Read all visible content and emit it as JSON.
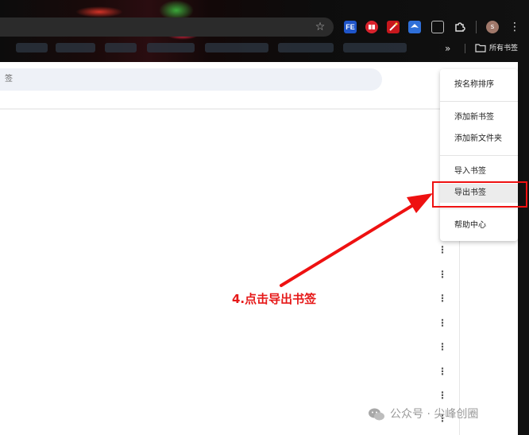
{
  "toolbar": {
    "star_icon": "star-icon",
    "extensions": [
      {
        "name": "fe-extension-icon",
        "label": "FE",
        "color": "#1f55c9"
      },
      {
        "name": "book-extension-icon",
        "label": "",
        "color": "#d9232d"
      },
      {
        "name": "red-extension-icon",
        "label": "",
        "color": "#c7171d"
      },
      {
        "name": "blue-bird-extension-icon",
        "label": "",
        "color": "#2f6fd8"
      },
      {
        "name": "window-extension-icon",
        "label": "",
        "color": "#555555"
      },
      {
        "name": "puzzle-extensions-icon",
        "label": "",
        "color": "#000000"
      }
    ],
    "avatar_label": "s"
  },
  "bookmarks_bar": {
    "more_label": "»",
    "all_bookmarks_label": "所有书签"
  },
  "search": {
    "placeholder_fragment": "签"
  },
  "menu": {
    "items": [
      {
        "label": "按名称排序"
      },
      {
        "label": "添加新书签"
      },
      {
        "label": "添加新文件夹"
      },
      {
        "label": "导入书签"
      },
      {
        "label": "导出书签"
      },
      {
        "label": "帮助中心"
      }
    ],
    "hovered_index": 4
  },
  "annotation": {
    "text": "4.点击导出书签",
    "color": "#e61919"
  },
  "watermark": {
    "text": "公众号 · 尖峰创圈"
  }
}
